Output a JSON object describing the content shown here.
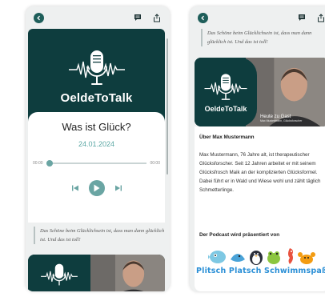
{
  "left_screen": {
    "brand": "OeldeToTalk",
    "episode": {
      "title": "Was ist Glück?",
      "date": "24.01.2024",
      "time_elapsed": "00:00",
      "time_total": "00:00",
      "progress": 0.0
    },
    "quote": "Das Schöne beim Glücklichsein ist, dass man dann glücklich ist. Und das ist toll!"
  },
  "right_screen": {
    "quote": "Das Schöne beim Glücklichsein ist, dass man dann glücklich ist. Und das ist toll!",
    "banner": {
      "brand": "OeldeToTalk",
      "caption": "Heute zu Gast",
      "caption_sub": "Max Mustermann, Glücksforscher"
    },
    "about": {
      "heading": "Über Max Mustermann",
      "text": "Max Mustermann, 76 Jahre alt, ist therapeutischer Glücksforscher. Seit 12 Jahren arbeitet er mit seinem Glücksfrosch Maik an der komplizierten Glücksformel. Dabei führt er in Wald und Wiese wohl und zählt täglich Schmetterlinge.",
      "podcast_label": "Der Podcast wird präsentiert von",
      "sponsor_name": "Plitsch Platsch Schwimmspaß"
    }
  },
  "icons": {
    "back": "chevron-left-icon",
    "chat": "chat-icon",
    "share": "share-icon",
    "prev": "skip-back-icon",
    "play": "play-icon",
    "next": "skip-forward-icon",
    "mic": "microphone-icon"
  },
  "colors": {
    "brand_dark": "#0e3d3e",
    "accent": "#6aa5a3",
    "date_color": "#5aa7a4",
    "sponsor_blue": "#2a8fd6"
  }
}
